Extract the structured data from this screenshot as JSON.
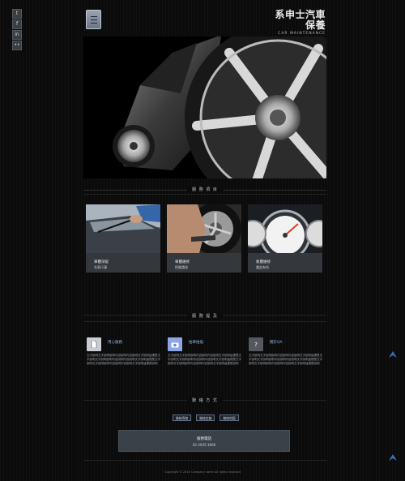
{
  "social": [
    {
      "icon": "twitter-icon",
      "glyph": "t"
    },
    {
      "icon": "facebook-icon",
      "glyph": "f"
    },
    {
      "icon": "linkedin-icon",
      "glyph": "in"
    },
    {
      "icon": "flickr-icon",
      "glyph": "••"
    }
  ],
  "header": {
    "logo_cn": "系申士汽車保養",
    "logo_en": "CAR MAINTENANCE"
  },
  "sections": {
    "services_title": "服 務 項 目",
    "features_title": "服 務 提 及",
    "contact_title": "聯 絡 方 式"
  },
  "services": [
    {
      "title": "車體深綻",
      "subtitle": "先車尺溝"
    },
    {
      "title": "車體維修",
      "subtitle": "把間請球"
    },
    {
      "title": "板體維修",
      "subtitle": "農此有所"
    }
  ],
  "features": [
    {
      "title": "用心服務",
      "icon": "document-icon",
      "text": "文字說明文字說明說明內容說明內容說明文字說明這裡是文字說明文字說明說明內容說明內容說明文字說明這裡是文字說明文字說明說明內容說明內容說明文字說明這裡是說明"
    },
    {
      "title": "拍車拍描",
      "icon": "camera-icon",
      "text": "文字說明文字說明說明內容說明內容說明文字說明這裡是文字說明文字說明說明內容說明內容說明文字說明這裡是文字說明文字說明說明內容說明內容說明文字說明這裡是說明"
    },
    {
      "title": "關於QA",
      "icon": "question-icon",
      "text": "文字說明文字說明說明內容說明內容說明文字說明這裡是文字說明文字說明說明內容說明內容說明文字說明這裡是文字說明文字說明說明內容說明內容說明文字說明這裡是說明"
    }
  ],
  "contact": {
    "buttons": [
      "聯絡專線",
      "聯絡信箱",
      "聯絡地圖"
    ],
    "phone_label": "服務電話",
    "phone_number": "02-2925-3666"
  },
  "footer": {
    "copyright": "Copyright © 2015 Company name All rights reserved"
  }
}
